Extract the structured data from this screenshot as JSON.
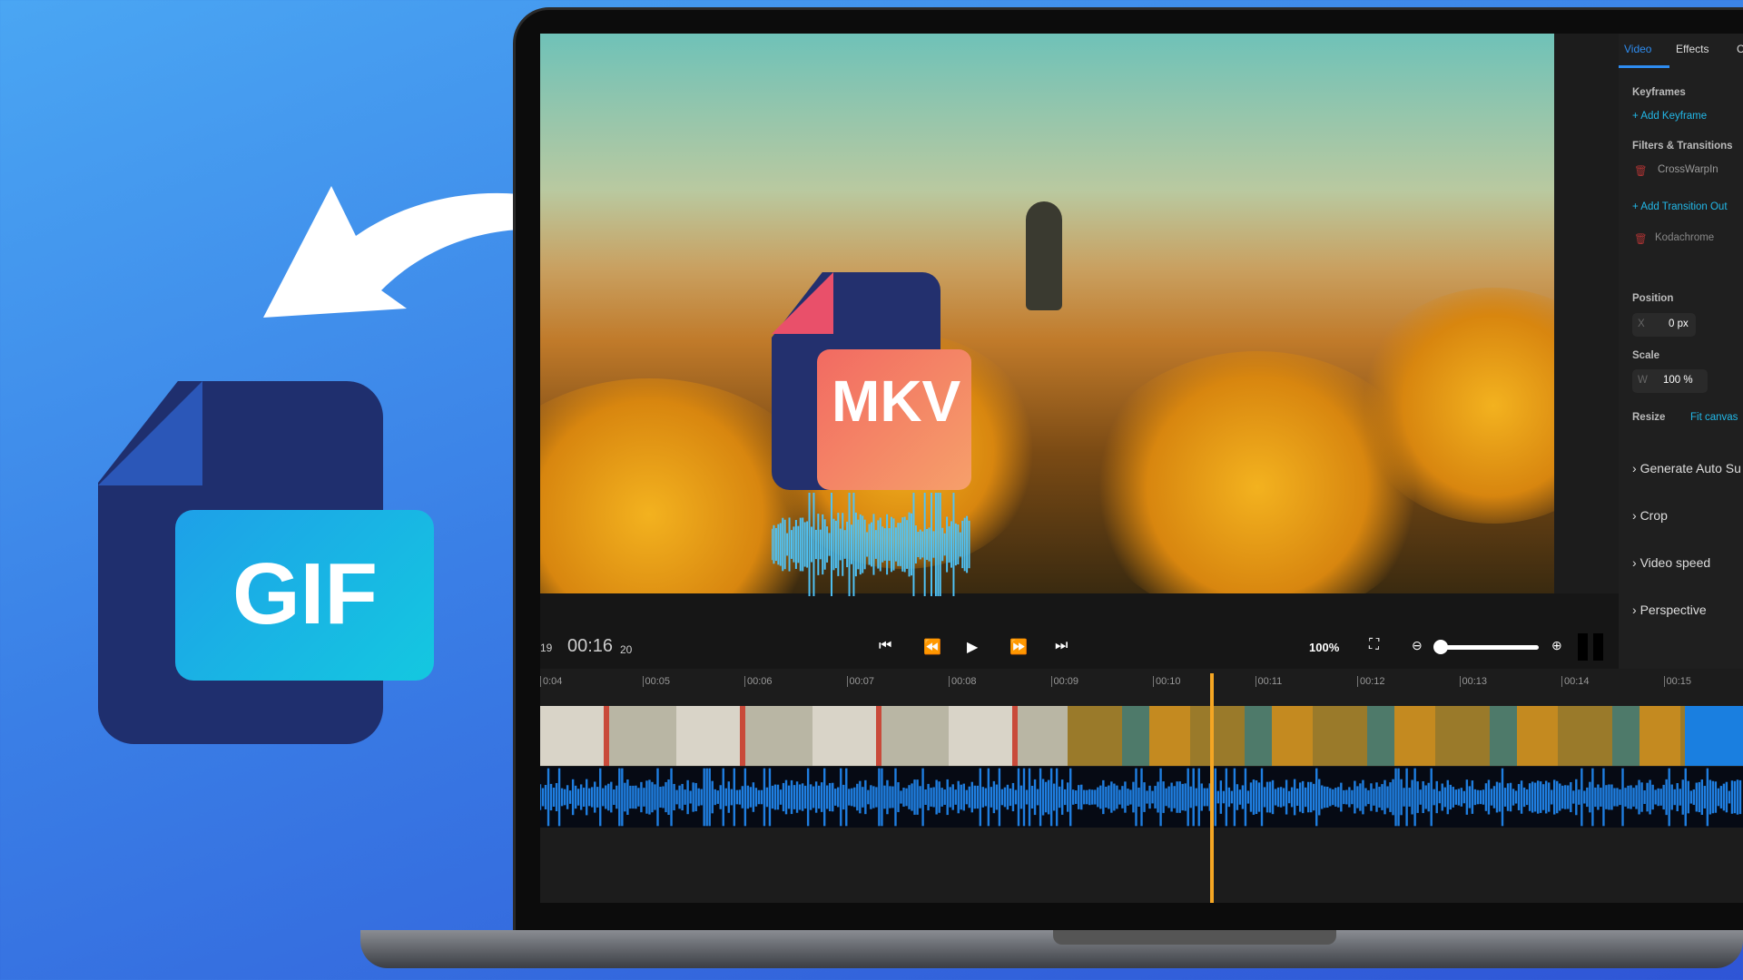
{
  "icons": {
    "gif_label": "GIF",
    "mkv_label": "MKV"
  },
  "panel": {
    "tabs": [
      {
        "label": "Video",
        "active": true
      },
      {
        "label": "Effects"
      },
      {
        "label": "C"
      }
    ],
    "keyframes_heading": "Keyframes",
    "add_keyframe": "+ Add Keyframe",
    "filters_heading": "Filters & Transitions",
    "filter1": "CrossWarpIn",
    "add_transition_out": "+ Add Transition Out",
    "filter2": "Kodachrome",
    "position_heading": "Position",
    "position_x_label": "X",
    "position_x_value": "0 px",
    "scale_heading": "Scale",
    "scale_w_label": "W",
    "scale_w_value": "100 %",
    "resize_label": "Resize",
    "resize_value": "Fit canvas",
    "sections": [
      "Generate Auto Su",
      "Crop",
      "Video speed",
      "Perspective"
    ]
  },
  "controls": {
    "frame_prev": "19",
    "time": "00:16",
    "frame_next": "20",
    "zoom": "100%",
    "zoom_slider_level": 0.0
  },
  "ruler": {
    "ticks": [
      "0:04",
      "00:05",
      "00:06",
      "00:07",
      "00:08",
      "00:09",
      "00:10",
      "00:11",
      "00:12",
      "00:13",
      "00:14",
      "00:15"
    ]
  },
  "colors": {
    "accent": "#22b8e8",
    "playhead": "#f5a623",
    "audio_wave": "#1f7ee0"
  }
}
